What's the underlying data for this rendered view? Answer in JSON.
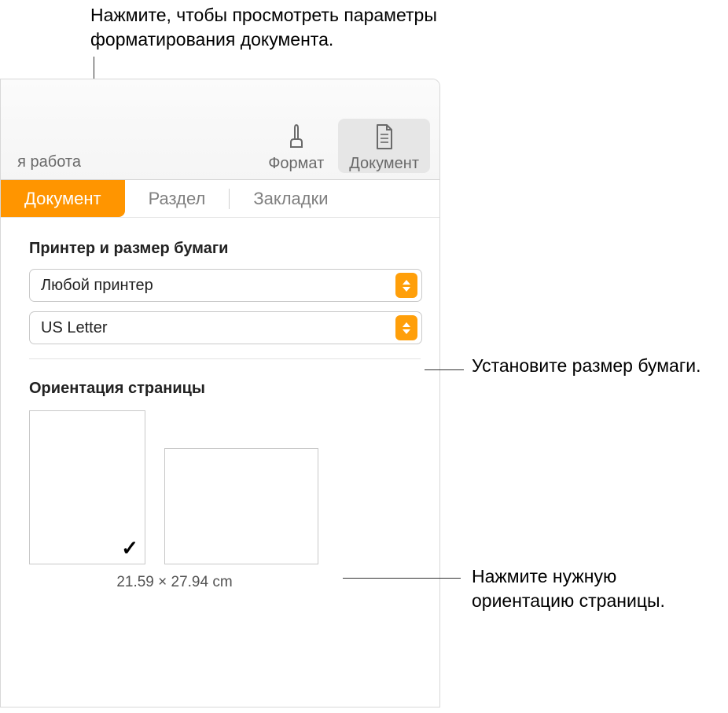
{
  "callouts": {
    "top": "Нажмите, чтобы просмотреть параметры форматирования документа.",
    "paper": "Установите размер бумаги.",
    "orient": "Нажмите нужную ориентацию страницы."
  },
  "toolbar": {
    "left_clip": "я работа",
    "format_label": "Формат",
    "document_label": "Документ"
  },
  "tabs": {
    "document": "Документ",
    "section": "Раздел",
    "bookmarks": "Закладки"
  },
  "printer_section": {
    "title": "Принтер и размер бумаги",
    "printer_value": "Любой принтер",
    "paper_value": "US Letter"
  },
  "orientation_section": {
    "title": "Ориентация страницы",
    "checkmark": "✓",
    "dimensions": "21.59 × 27.94 cm"
  }
}
